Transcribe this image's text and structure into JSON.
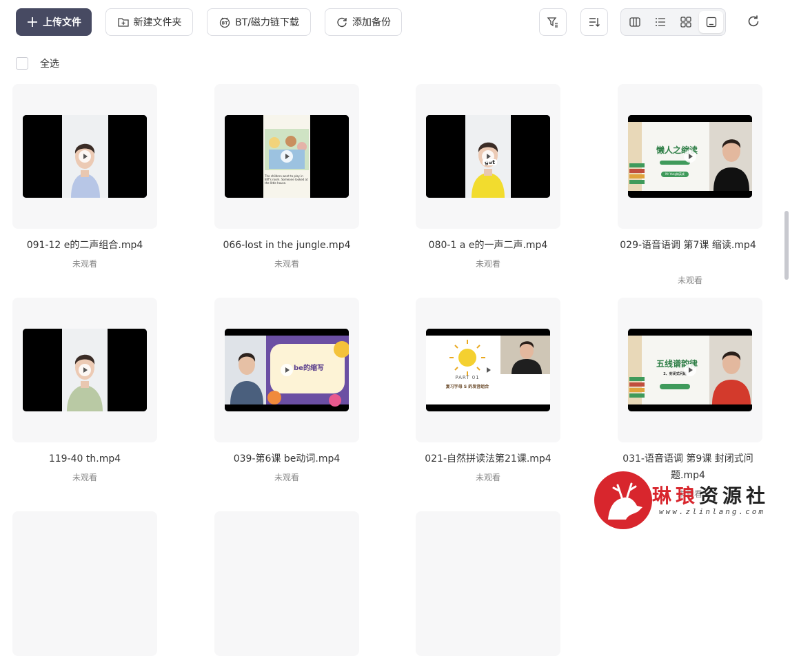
{
  "toolbar": {
    "upload_label": "上传文件",
    "new_folder_label": "新建文件夹",
    "bt_label": "BT/磁力链下载",
    "backup_label": "添加备份"
  },
  "select_all_label": "全选",
  "files": [
    {
      "name": "091-12 e的二声组合.mp4",
      "status": "未观看",
      "thumb": "person-blue",
      "thumb_text": ""
    },
    {
      "name": "066-lost in the jungle.mp4",
      "status": "未观看",
      "thumb": "storybook",
      "thumb_text": "The children went to play in Biff's room. Someone looked at the little house."
    },
    {
      "name": "080-1 a e的一声二声.mp4",
      "status": "未观看",
      "thumb": "person-yellow",
      "thumb_text": "get"
    },
    {
      "name": "029-语音语调 第7课 缩读.mp4",
      "status": "未观看",
      "thumb": "slide-books",
      "thumb_text": "懒人之缩读",
      "thumb_sub": "Mr Yang纳英成"
    },
    {
      "name": "119-40 th.mp4",
      "status": "未观看",
      "thumb": "person-green",
      "thumb_text": ""
    },
    {
      "name": "039-第6课 be动词.mp4",
      "status": "未观看",
      "thumb": "slide-colorful",
      "thumb_text": "be的缩写"
    },
    {
      "name": "021-自然拼读法第21课.mp4",
      "status": "未观看",
      "thumb": "slide-sun",
      "thumb_text": "PART 01",
      "thumb_sub": "复习字母 S 的发音组合"
    },
    {
      "name": "031-语音语调 第9课 封闭式问题.mp4",
      "status": "未观看",
      "thumb": "slide-books-red",
      "thumb_text": "五线谱韵律",
      "thumb_sub": "2、封闭式问题"
    }
  ],
  "watermark": {
    "title_red": "琳琅",
    "title_rest": "资源社",
    "url": "www.zlinlang.com"
  },
  "colors": {
    "primary": "#474a62",
    "accent": "#d8262d"
  }
}
